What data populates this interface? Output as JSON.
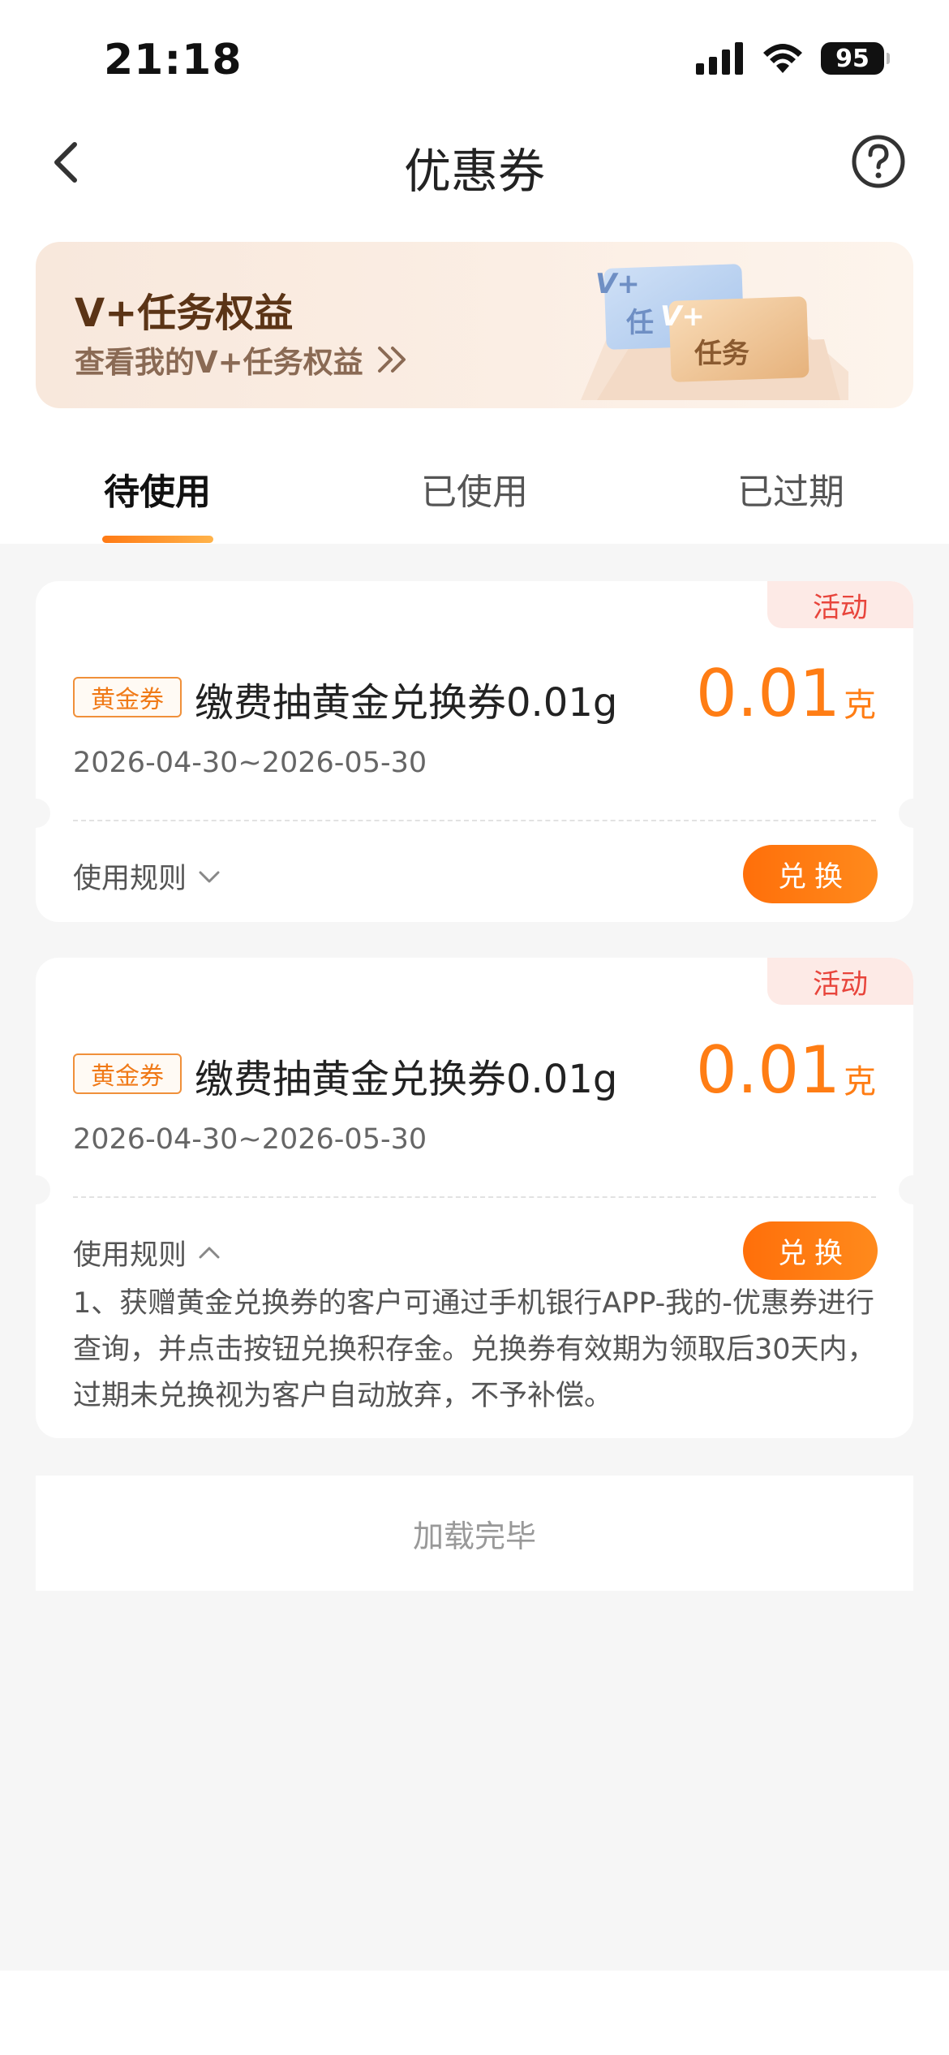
{
  "status": {
    "time": "21:18",
    "battery": "95"
  },
  "nav": {
    "title": "优惠券"
  },
  "banner": {
    "title": "V+任务权益",
    "subtitle": "查看我的V+任务权益",
    "card_back": "V+\n任",
    "card_front_top": "V+",
    "card_front_label": "任务"
  },
  "tabs": [
    {
      "label": "待使用",
      "active": true
    },
    {
      "label": "已使用",
      "active": false
    },
    {
      "label": "已过期",
      "active": false
    }
  ],
  "coupons": [
    {
      "tag": "活动",
      "type": "黄金券",
      "name": "缴费抽黄金兑换券0.01g",
      "date": "2026-04-30~2026-05-30",
      "amount": "0.01",
      "unit": "克",
      "rules_label": "使用规则",
      "button": "兑换",
      "expanded": false
    },
    {
      "tag": "活动",
      "type": "黄金券",
      "name": "缴费抽黄金兑换券0.01g",
      "date": "2026-04-30~2026-05-30",
      "amount": "0.01",
      "unit": "克",
      "rules_label": "使用规则",
      "button": "兑换",
      "expanded": true,
      "rules_text": "1、获赠黄金兑换券的客户可通过手机银行APP-我的-优惠券进行查询，并点击按钮兑换积存金。兑换券有效期为领取后30天内，过期未兑换视为客户自动放弃，不予补偿。"
    }
  ],
  "footer": {
    "text": "加载完毕"
  },
  "colors": {
    "accent": "#ff7d14",
    "activity_tag": "#e8453c",
    "banner_title": "#5b3416"
  }
}
